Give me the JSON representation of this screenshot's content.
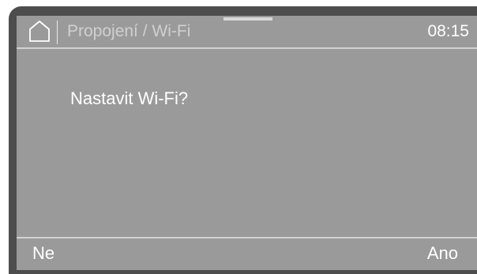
{
  "header": {
    "breadcrumb": "Propojení / Wi-Fi",
    "time": "08:15"
  },
  "dialog": {
    "question": "Nastavit Wi-Fi?"
  },
  "footer": {
    "no_label": "Ne",
    "yes_label": "Ano"
  },
  "icons": {
    "home": "home-icon"
  },
  "colors": {
    "bezel": "#4d4d4d",
    "screen": "#9a9a9a",
    "text": "#ffffff",
    "breadcrumb": "#d0d0d0",
    "divider": "#d2d2d2"
  }
}
